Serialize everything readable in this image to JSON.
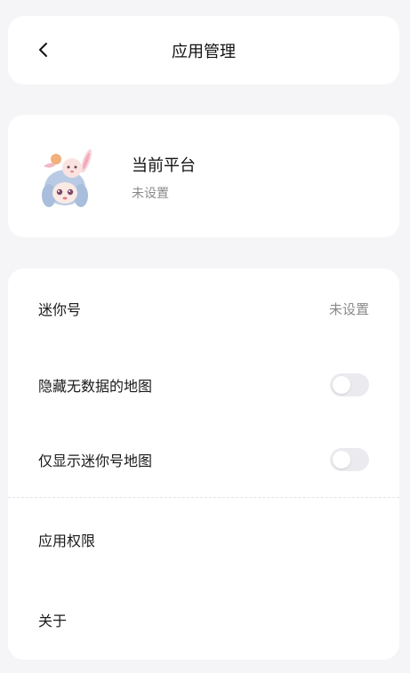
{
  "header": {
    "title": "应用管理",
    "back_icon": "chevron-left-icon"
  },
  "profile": {
    "name": "当前平台",
    "subtitle": "未设置",
    "avatar": "anime-girl-with-bunny-avatar"
  },
  "settings": {
    "mini_id": {
      "label": "迷你号",
      "value": "未设置"
    },
    "hide_no_data_maps": {
      "label": "隐藏无数据的地图",
      "enabled": false
    },
    "show_mini_id_maps_only": {
      "label": "仅显示迷你号地图",
      "enabled": false
    },
    "permissions": {
      "label": "应用权限"
    },
    "about": {
      "label": "关于"
    }
  },
  "colors": {
    "background": "#f5f5f7",
    "card": "#ffffff",
    "secondary_text": "#8a8a8a",
    "toggle_off": "#ebebef"
  }
}
